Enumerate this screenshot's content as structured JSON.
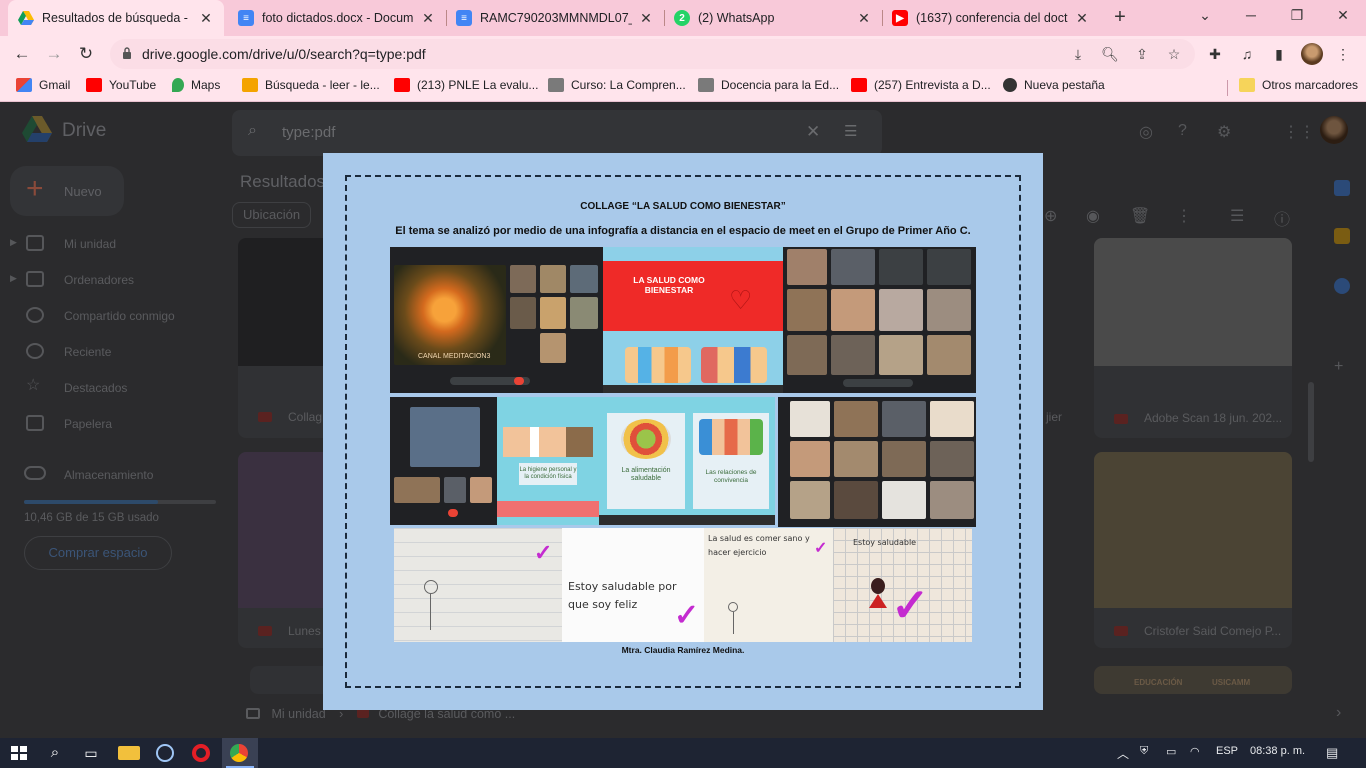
{
  "tabs": [
    {
      "title": "Resultados de búsqueda - Go",
      "favicon": "google-drive-icon",
      "active": true
    },
    {
      "title": "foto dictados.docx - Docume",
      "favicon": "google-docs-icon",
      "active": false
    },
    {
      "title": "RAMC790203MMNMDL07_N",
      "favicon": "google-docs-icon",
      "active": false
    },
    {
      "title": "(2) WhatsApp",
      "favicon": "whatsapp-icon",
      "active": false,
      "badge": "2"
    },
    {
      "title": "(1637) conferencia del docto",
      "favicon": "youtube-icon",
      "active": false
    }
  ],
  "toolbar": {
    "url": "drive.google.com/drive/u/0/search?q=type:pdf"
  },
  "bookmarks": [
    {
      "label": "Gmail",
      "icon": "gmail-icon",
      "color": "#ea4335"
    },
    {
      "label": "YouTube",
      "icon": "youtube-icon",
      "color": "#ff0000"
    },
    {
      "label": "Maps",
      "icon": "maps-icon",
      "color": "#34a853"
    },
    {
      "label": "Búsqueda - leer - le...",
      "icon": "lp-icon",
      "color": "#f4a300"
    },
    {
      "label": "(213) PNLE La evalu...",
      "icon": "youtube-icon",
      "color": "#ff0000"
    },
    {
      "label": "Curso: La Compren...",
      "icon": "course-icon",
      "color": "#7a7a7a"
    },
    {
      "label": "Docencia para la Ed...",
      "icon": "course-icon",
      "color": "#7a7a7a"
    },
    {
      "label": "(257) Entrevista a D...",
      "icon": "youtube-icon",
      "color": "#ff0000"
    },
    {
      "label": "Nueva pestaña",
      "icon": "globe-icon",
      "color": "#333333"
    }
  ],
  "other_bookmarks": "Otros marcadores",
  "drive": {
    "logo": "Drive",
    "search_query": "type:pdf",
    "new_button": "Nuevo",
    "sidebar": [
      {
        "label": "Mi unidad",
        "has_arrow": true
      },
      {
        "label": "Ordenadores",
        "has_arrow": true
      },
      {
        "label": "Compartido conmigo",
        "has_arrow": false
      },
      {
        "label": "Reciente",
        "has_arrow": false
      },
      {
        "label": "Destacados",
        "has_arrow": false
      },
      {
        "label": "Papelera",
        "has_arrow": false
      }
    ],
    "storage_label": "Almacenamiento",
    "storage_used_fraction": 0.7,
    "storage_text": "10,46 GB de 15 GB usado",
    "buy_storage": "Comprar espacio",
    "results_title": "Resultados",
    "location_chip": "Ubicación",
    "cards": [
      {
        "caption": "Collag"
      },
      {
        "caption": "Adobe Scan 18 jun. 202..."
      },
      {
        "caption": "Lunes"
      },
      {
        "caption": "Cristofer Said Comejo P..."
      }
    ],
    "card_partial": "jier",
    "card_bottom_text": [
      "EDUCACIÓN",
      "USICAMM"
    ],
    "breadcrumb_root": "Mi unidad",
    "breadcrumb_file": "Collage la salud como ..."
  },
  "preview": {
    "title": "COLLAGE “LA SALUD COMO BIENESTAR”",
    "subtitle": "El tema se analizó por medio de una infografía a distancia en el espacio de meet en el Grupo de Primer Año C.",
    "poster_title": "LA SALUD COMO BIENESTAR",
    "meet_caption": "CANAL MEDITACION3",
    "info_cards": [
      "La alimentación saludable",
      "Las relaciones de convivencia",
      "La higiene personal y la condición física"
    ],
    "handwriting": [
      "Estoy saludable por que soy feliz",
      "La salud es comer sano y hacer ejercicio",
      "Estoy saludable"
    ],
    "signature": "Mtra. Claudia  Ramírez Medina."
  },
  "taskbar": {
    "language": "ESP",
    "time": "08:38 p. m."
  }
}
